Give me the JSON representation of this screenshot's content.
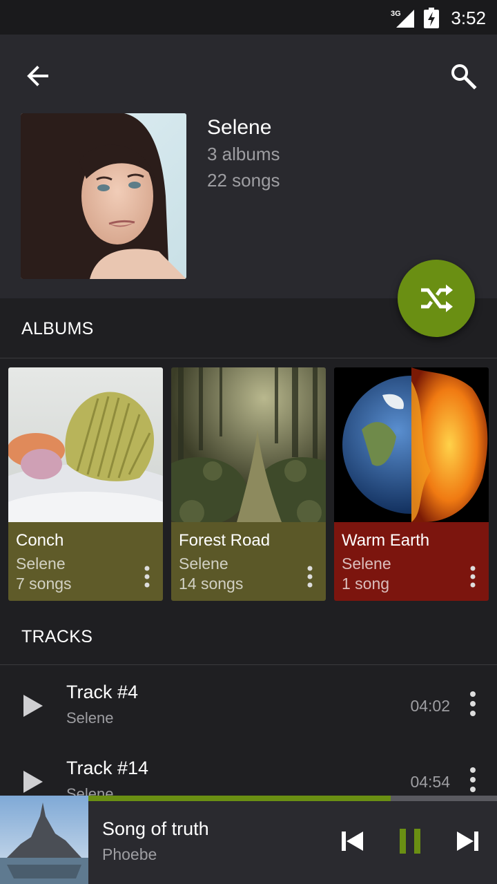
{
  "status_bar": {
    "network": "3G",
    "time": "3:52"
  },
  "header": {
    "back_icon": "arrow-left-icon",
    "search_icon": "search-icon",
    "artist_name": "Selene",
    "albums_count": "3 albums",
    "songs_count": "22 songs"
  },
  "shuffle_icon": "shuffle-icon",
  "colors": {
    "accent": "#6a8f13",
    "header_bg": "#29292e",
    "page_bg": "#1f1f22"
  },
  "albums": {
    "heading": "ALBUMS",
    "items": [
      {
        "title": "Conch",
        "artist": "Selene",
        "count": "7 songs",
        "color": "#5f5b29"
      },
      {
        "title": "Forest Road",
        "artist": "Selene",
        "count": "14 songs",
        "color": "#5b5828"
      },
      {
        "title": "Warm Earth",
        "artist": "Selene",
        "count": "1 song",
        "color": "#7c150e"
      }
    ]
  },
  "tracks": {
    "heading": "TRACKS",
    "items": [
      {
        "title": "Track #4",
        "artist": "Selene",
        "duration": "04:02"
      },
      {
        "title": "Track #14",
        "artist": "Selene",
        "duration": "04:54"
      }
    ]
  },
  "now_playing": {
    "title": "Song of truth",
    "artist": "Phoebe",
    "progress": 0.74,
    "state": "playing"
  }
}
